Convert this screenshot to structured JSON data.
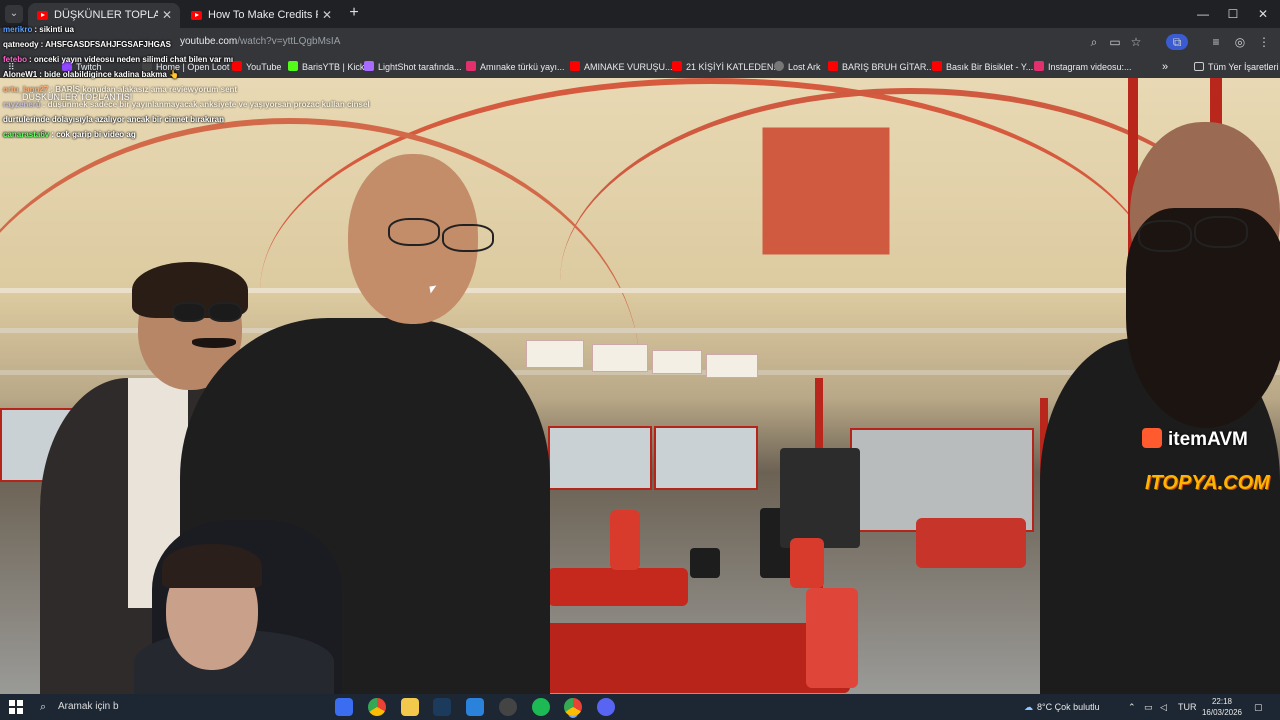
{
  "browser": {
    "tabs": [
      {
        "title": "DÜŞKÜNLER TOPLANTISI - You",
        "active": true
      },
      {
        "title": "How To Make Credits Fast In Ar",
        "active": false
      }
    ],
    "new_tab_label": "+",
    "window_controls": {
      "minimize": "—",
      "maximize": "☐",
      "close": "✕"
    },
    "url": {
      "host": "youtube.com",
      "path": "/watch?v=yttLQgbMsIA"
    },
    "bookmarks": [
      {
        "label": "Twitch",
        "color": "#9146ff"
      },
      {
        "label": "Home | Open Loot",
        "color": "#333333"
      },
      {
        "label": "YouTube",
        "color": "#ff0000"
      },
      {
        "label": "BarisYTB | Kick",
        "color": "#53fc18"
      },
      {
        "label": "LightShot tarafında...",
        "color": "#a86bff"
      },
      {
        "label": "Amınake türkü yayı...",
        "color": "#e1306c"
      },
      {
        "label": "AMINAKE VURUŞU...",
        "color": "#ff0000"
      },
      {
        "label": "21 KİŞİYİ KATLEDEN...",
        "color": "#ff0000"
      },
      {
        "label": "Lost Ark",
        "color": "#777777"
      },
      {
        "label": "BARIŞ BRUH GİTAR...",
        "color": "#ff0000"
      },
      {
        "label": "Basık Bir Bisiklet - Y...",
        "color": "#ff0000"
      },
      {
        "label": "Instagram videosu:...",
        "color": "#e1306c"
      }
    ],
    "bookmarks_overflow": "»",
    "all_bookmarks": "Tüm Yer İşaretleri"
  },
  "chat": [
    {
      "user": "merikro",
      "msg": ": sikinti ua",
      "color": "#5aa0ff"
    },
    {
      "user": "qatneody",
      "msg": ": AHSFGASDFSAHJFGSAFJHGAS",
      "color": "#ffffff"
    },
    {
      "user": "fetebo",
      "msg": ": onceki yayın videosu neden silimdi chat bilen var mı",
      "color": "#ff66cc"
    },
    {
      "user": "AloneW1",
      "msg": ": bide olabildigince kadina bakma 👆",
      "color": "#ffffff"
    },
    {
      "user": "ortu_lann27",
      "msg": ": BARİŞ konudan alakasız ama reviewyorum sent",
      "color": "#ff8844"
    },
    {
      "user": "rayzeneru",
      "msg": ": düşünmek sadece bir yayınlanmayacak anksiyete ve yaşıyorsan prozac kullan cinsel",
      "color": "#aaaaff"
    },
    {
      "user": "",
      "msg": "durtulerinde dolayısıyla azalıyor ancak bir cinnet bırakıran",
      "color": "#ffffff"
    },
    {
      "user": "canarasta6v",
      "msg": ": cok garip bi video ag",
      "color": "#66ff66"
    }
  ],
  "video": {
    "overlay_title": "DÜŞKÜNLER TOPLANTISI",
    "sponsor_1": "itemAVM",
    "sponsor_2": "ITOPYA.COM"
  },
  "taskbar": {
    "search_placeholder": "Aramak için b",
    "weather": "8°C  Çok bulutlu",
    "language": "TUR",
    "time": "22:18",
    "date": "16/03/2026"
  }
}
